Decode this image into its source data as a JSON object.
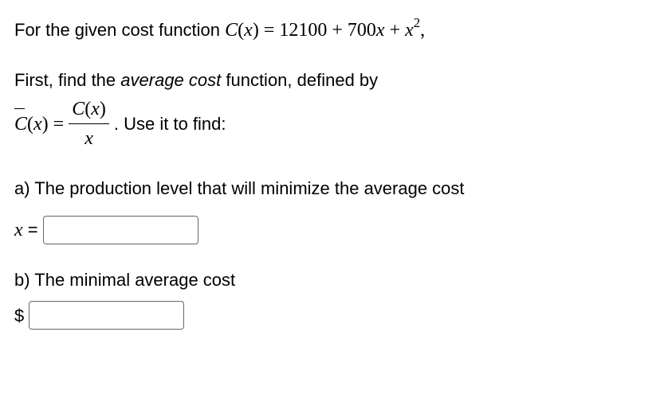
{
  "line1_prefix": "For the given cost function ",
  "cost_fn_lhs_C": "C",
  "cost_fn_lhs_paren_open": "(",
  "cost_fn_lhs_x": "x",
  "cost_fn_lhs_paren_close": ")",
  "cost_fn_eq": " = ",
  "cost_fn_rhs_c0": "12100",
  "cost_fn_rhs_plus1": " + ",
  "cost_fn_rhs_c1": "700",
  "cost_fn_rhs_x1": "x",
  "cost_fn_rhs_plus2": " + ",
  "cost_fn_rhs_x2": "x",
  "cost_fn_rhs_exp": "2",
  "cost_fn_comma": ",",
  "line2_prefix": "First, find the ",
  "line2_italic": "average cost",
  "line2_suffix": " function, defined by",
  "avg_C_bar": "C",
  "avg_paren_open": "(",
  "avg_x": "x",
  "avg_paren_close": ")",
  "avg_eq": " = ",
  "frac_num_C": "C",
  "frac_num_po": "(",
  "frac_num_x": "x",
  "frac_num_pc": ")",
  "frac_den_x": "x",
  "formula_suffix": ". Use it to find:",
  "part_a_text": "a) The production level that will minimize the average cost",
  "part_a_label_x": "x",
  "part_a_label_eq": " = ",
  "part_b_text": "b) The minimal average cost",
  "part_b_label": "$"
}
